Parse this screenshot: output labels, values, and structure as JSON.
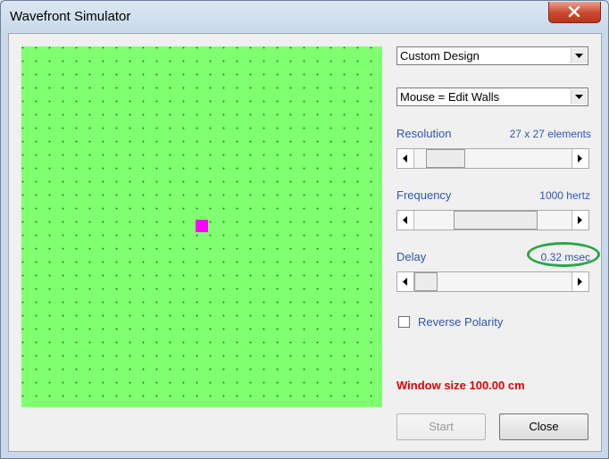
{
  "window": {
    "title": "Wavefront Simulator"
  },
  "design_select": {
    "value": "Custom Design"
  },
  "mouse_select": {
    "value": "Mouse = Edit Walls"
  },
  "resolution": {
    "label": "Resolution",
    "value": "27 x 27 elements",
    "position": 0.1
  },
  "frequency": {
    "label": "Frequency",
    "value": "1000 hertz",
    "position": 0.52
  },
  "delay": {
    "label": "Delay",
    "value": "0.32 msec",
    "position": 0.0
  },
  "reverse_polarity": {
    "label": "Reverse Polarity",
    "checked": false
  },
  "window_size": {
    "text": "Window size 100.00 cm"
  },
  "buttons": {
    "start": "Start",
    "close": "Close"
  },
  "colors": {
    "grid_bg": "#80ff70",
    "source": "#ff00ff",
    "accent_text": "#2f55b4",
    "warning": "#e00000",
    "annotation": "#2aa64a"
  }
}
